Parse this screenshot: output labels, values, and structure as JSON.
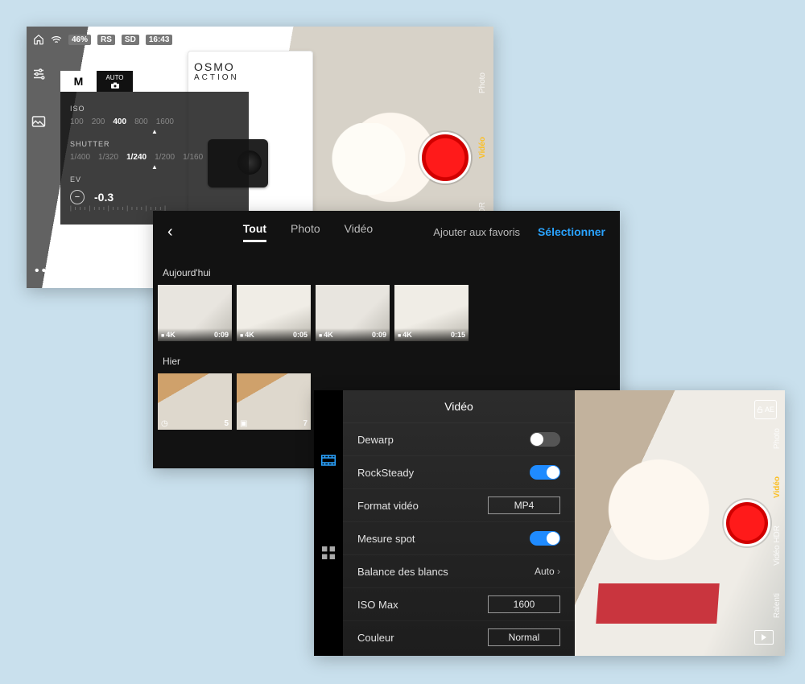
{
  "colors": {
    "accent_blue": "#2aa3ff",
    "record_red": "#ff1a1a",
    "mode_active": "#fbbf24"
  },
  "screen1": {
    "status": {
      "battery_pct": "46%",
      "badge1": "RS",
      "badge2": "SD",
      "time": "16:43"
    },
    "product_box": {
      "line1": "OSMO",
      "line2": "ACTION"
    },
    "mode_pill": {
      "manual": "M",
      "auto": "AUTO"
    },
    "exposure": {
      "iso_label": "ISO",
      "iso_options": [
        "100",
        "200",
        "400",
        "800",
        "1600"
      ],
      "iso_active": "400",
      "shutter_label": "SHUTTER",
      "shutter_options": [
        "1/400",
        "1/320",
        "1/240",
        "1/200",
        "1/160"
      ],
      "shutter_active": "1/240",
      "ev_label": "EV",
      "ev_value": "-0.3"
    },
    "mode_column": [
      "Photo",
      "Vidéo",
      "Vidéo HDR"
    ],
    "mode_column_active": "Vidéo"
  },
  "screen2": {
    "tabs": [
      "Tout",
      "Photo",
      "Vidéo"
    ],
    "tab_active": "Tout",
    "favorites_label": "Ajouter aux favoris",
    "select_label": "Sélectionner",
    "groups": [
      {
        "label": "Aujourd'hui",
        "items": [
          {
            "res": "4K",
            "dur": "0:09"
          },
          {
            "res": "4K",
            "dur": "0:05"
          },
          {
            "res": "4K",
            "dur": "0:09"
          },
          {
            "res": "4K",
            "dur": "0:15"
          }
        ]
      },
      {
        "label": "Hier",
        "items": [
          {
            "count": "5"
          },
          {
            "count": "7"
          }
        ]
      }
    ]
  },
  "screen3": {
    "title": "Vidéo",
    "rows": {
      "dewarp": {
        "label": "Dewarp",
        "value": false,
        "kind": "toggle"
      },
      "rocksteady": {
        "label": "RockSteady",
        "value": true,
        "kind": "toggle"
      },
      "format": {
        "label": "Format vidéo",
        "value": "MP4",
        "kind": "box"
      },
      "spot": {
        "label": "Mesure spot",
        "value": true,
        "kind": "toggle"
      },
      "whitebalance": {
        "label": "Balance des blancs",
        "value": "Auto",
        "kind": "link"
      },
      "iso_max": {
        "label": "ISO Max",
        "value": "1600",
        "kind": "box"
      },
      "color": {
        "label": "Couleur",
        "value": "Normal",
        "kind": "box"
      }
    },
    "ae_lock_label": "AE",
    "mode_column": [
      "Photo",
      "Vidéo",
      "Vidéo HDR",
      "Ralenti"
    ],
    "mode_column_active": "Vidéo"
  }
}
